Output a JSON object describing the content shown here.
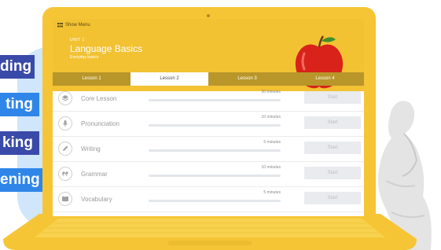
{
  "skills": [
    "ding",
    "ting",
    "king",
    "ening"
  ],
  "app": {
    "menu_label": "Show Menu",
    "unit_label": "UNIT 1",
    "title": "Language Basics",
    "subtitle": "Everyday basics"
  },
  "tabs": [
    {
      "label": "Lesson 1",
      "active": false
    },
    {
      "label": "Lesson 2",
      "active": true
    },
    {
      "label": "Lesson 3",
      "active": false
    },
    {
      "label": "Lesson 4",
      "active": false
    }
  ],
  "lessons": [
    {
      "name": "Core Lesson",
      "time": "30 minutes",
      "button": "Start",
      "icon": "layers-icon",
      "progress": 0
    },
    {
      "name": "Pronunciation",
      "time": "10 minutes",
      "button": "Start",
      "icon": "microphone-icon",
      "progress": 0
    },
    {
      "name": "Writing",
      "time": "5 minutes",
      "button": "Start",
      "icon": "pencil-icon",
      "progress": 0
    },
    {
      "name": "Grammar",
      "time": "10 minutes",
      "button": "Start",
      "icon": "quote-icon",
      "progress": 0
    },
    {
      "name": "Vocabulary",
      "time": "5 minutes",
      "button": "Start",
      "icon": "book-icon",
      "progress": 0
    }
  ],
  "colors": {
    "laptop": "#f5c535",
    "header": "#f2c233",
    "tab_bar": "#b8962a",
    "skill_dark": "#3a4aa8",
    "skill_light": "#2f86e8"
  }
}
